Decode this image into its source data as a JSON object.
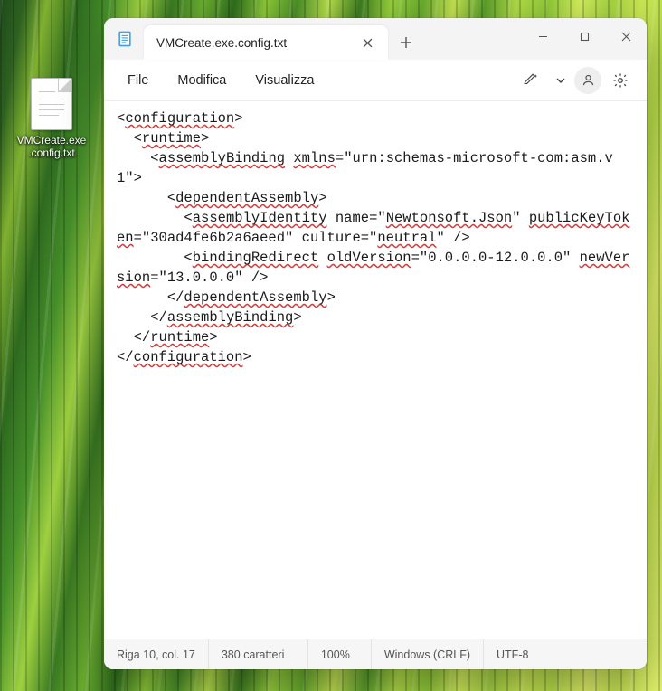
{
  "desktop": {
    "icon": {
      "line1": "VMCreate.exe",
      "line2": ".config.txt"
    }
  },
  "window": {
    "tab_title": "VMCreate.exe.config.txt",
    "menu": {
      "file": "File",
      "edit": "Modifica",
      "view": "Visualizza"
    },
    "status": {
      "cursor": "Riga 10, col. 17",
      "chars": "380 caratteri",
      "zoom": "100%",
      "eol": "Windows (CRLF)",
      "encoding": "UTF-8"
    }
  },
  "content": {
    "l1a": "configuration",
    "l2a": "runtime",
    "l3a": "assemblyBinding",
    "l3b": "xmlns",
    "l3c": "=\"urn:schemas-microsoft-com:asm.v1\">",
    "l4a": "dependentAssembly",
    "l5a": "assemblyIdentity",
    "l5b": " name=\"",
    "l5c": "Newtonsoft.Json",
    "l5d": "\" ",
    "l5e": "publicKeyToken",
    "l5f": "=\"30ad4fe6b2a6aeed\" culture=\"",
    "l5g": "neutral",
    "l5h": "\" />",
    "l6a": "bindingRedirect",
    "l6b": "oldVersion",
    "l6c": "=\"0.0.0.0-12.0.0.0\" ",
    "l6d": "newVersion",
    "l6e": "=\"13.0.0.0\" />",
    "l7a": "dependentAssembly",
    "l8a": "assemblyBinding",
    "l9a": "runtime",
    "l10a": "configuration"
  }
}
